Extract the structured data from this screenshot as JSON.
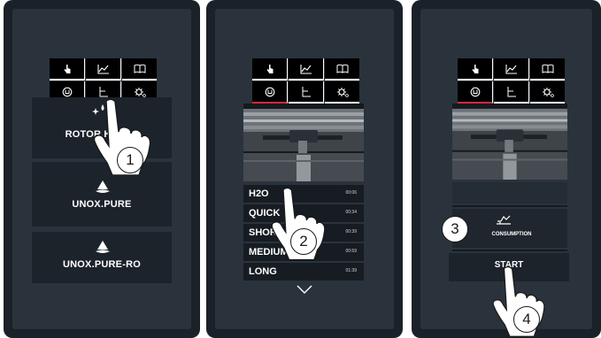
{
  "colors": {
    "accent": "#d4283b",
    "panel": "#1b2128",
    "screen": "#2a333c"
  },
  "tab_icons": [
    "hand-touch-icon",
    "chart-icon",
    "book-icon",
    "washing-icon",
    "drain-icon",
    "settings-icon"
  ],
  "panel1": {
    "buttons": [
      "ROTOR.KLEAN",
      "UNOX.PURE",
      "UNOX.PURE-RO"
    ],
    "step": "1"
  },
  "panel2": {
    "programs": [
      {
        "name": "H2O",
        "time": "00:06"
      },
      {
        "name": "QUICK",
        "time": "00:34"
      },
      {
        "name": "SHORT",
        "time": "00:39"
      },
      {
        "name": "MEDIUM",
        "time": "00:59"
      },
      {
        "name": "LONG",
        "time": "01:39"
      }
    ],
    "step": "2"
  },
  "panel3": {
    "consumption_label": "CONSUMPTION",
    "start_label": "START",
    "step_consumption": "3",
    "step_start": "4"
  }
}
